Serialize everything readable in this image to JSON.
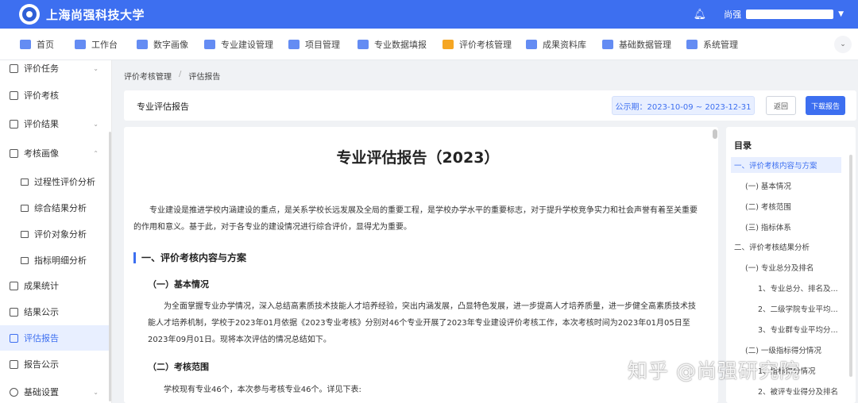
{
  "header": {
    "title": "上海尚强科技大学",
    "user_name": "尚强",
    "bell_icon": "bell-icon",
    "accent": "#3d6ff0"
  },
  "nav": {
    "items": [
      {
        "label": "首页",
        "icon": "home-icon",
        "color": "#3d6ff0"
      },
      {
        "label": "工作台",
        "icon": "monitor-icon",
        "color": "#3d6ff0"
      },
      {
        "label": "数字画像",
        "icon": "document-icon",
        "color": "#3d6ff0"
      },
      {
        "label": "专业建设管理",
        "icon": "shield-gear-icon",
        "color": "#3d6ff0"
      },
      {
        "label": "项目管理",
        "icon": "flask-icon",
        "color": "#3d6ff0"
      },
      {
        "label": "专业数据填报",
        "icon": "id-card-icon",
        "color": "#3d6ff0"
      },
      {
        "label": "评价考核管理",
        "icon": "medal-icon",
        "color": "#f5a623"
      },
      {
        "label": "成果资料库",
        "icon": "folder-icon",
        "color": "#3d6ff0"
      },
      {
        "label": "基础数据管理",
        "icon": "database-icon",
        "color": "#3d6ff0"
      },
      {
        "label": "系统管理",
        "icon": "shield-icon",
        "color": "#3d6ff0"
      }
    ]
  },
  "sidebar": {
    "items": [
      {
        "label": "评价任务",
        "level": 1,
        "caret": "⌄"
      },
      {
        "label": "评价考核",
        "level": 1,
        "caret": ""
      },
      {
        "label": "评价结果",
        "level": 1,
        "caret": "⌄"
      },
      {
        "label": "考核画像",
        "level": 1,
        "caret": "⌃"
      },
      {
        "label": "过程性评价分析",
        "level": 2,
        "caret": ""
      },
      {
        "label": "综合结果分析",
        "level": 2,
        "caret": ""
      },
      {
        "label": "评价对象分析",
        "level": 2,
        "caret": ""
      },
      {
        "label": "指标明细分析",
        "level": 2,
        "caret": ""
      },
      {
        "label": "成果统计",
        "level": 1,
        "caret": ""
      },
      {
        "label": "结果公示",
        "level": 1,
        "caret": ""
      },
      {
        "label": "评估报告",
        "level": 1,
        "caret": "",
        "active": true
      },
      {
        "label": "报告公示",
        "level": 1,
        "caret": ""
      },
      {
        "label": "基础设置",
        "level": 1,
        "caret": "⌄"
      }
    ]
  },
  "breadcrumb": {
    "parent": "评价考核管理",
    "separator": "/",
    "current": "评估报告"
  },
  "titlebar": {
    "title": "专业评估报告",
    "period": "公示期：2023-10-09 ~ 2023-12-31",
    "back_label": "返回",
    "download_label": "下载报告"
  },
  "document": {
    "title": "专业评估报告（2023）",
    "intro": "专业建设是推进学校内涵建设的重点，是关系学校长远发展及全局的重要工程，是学校办学水平的重要标志，对于提升学校竞争实力和社会声誉有着至关重要的作用和意义。基于此，对于各专业的建设情况进行综合评价，显得尤为重要。",
    "section1": "一、评价考核内容与方案",
    "sub1": "（一）基本情况",
    "sub1_text": "为全面掌握专业办学情况，深入总结高素质技术技能人才培养经验，突出内涵发展，凸显特色发展，进一步提高人才培养质量，进一步健全高素质技术技能人才培养机制，学校于2023年01月依据《2023专业考核》分别对46个专业开展了2023年专业建设评价考核工作，本次考核时间为2023年01月05日至2023年09月01日。现将本次评估的情况总结如下。",
    "sub2": "（二）考核范围",
    "sub2_text": "学校现有专业46个，本次参与考核专业46个。详见下表:"
  },
  "toc": {
    "title": "目录",
    "items": [
      {
        "label": "一、评价考核内容与方案",
        "indent": 0,
        "active": true
      },
      {
        "label": "(一) 基本情况",
        "indent": 1
      },
      {
        "label": "(二) 考核范围",
        "indent": 1
      },
      {
        "label": "(三) 指标体系",
        "indent": 1
      },
      {
        "label": "二、评价考核结果分析",
        "indent": 0
      },
      {
        "label": "(一) 专业总分及排名",
        "indent": 1
      },
      {
        "label": "1、专业总分、排名及...",
        "indent": 2
      },
      {
        "label": "2、二级学院专业平均...",
        "indent": 2
      },
      {
        "label": "3、专业群专业平均分...",
        "indent": 2
      },
      {
        "label": "(二) 一级指标得分情况",
        "indent": 1
      },
      {
        "label": "1、指标得分情况",
        "indent": 2
      },
      {
        "label": "2、被评专业得分及排名",
        "indent": 2
      }
    ]
  },
  "watermark": "知乎 @尚强研究院"
}
